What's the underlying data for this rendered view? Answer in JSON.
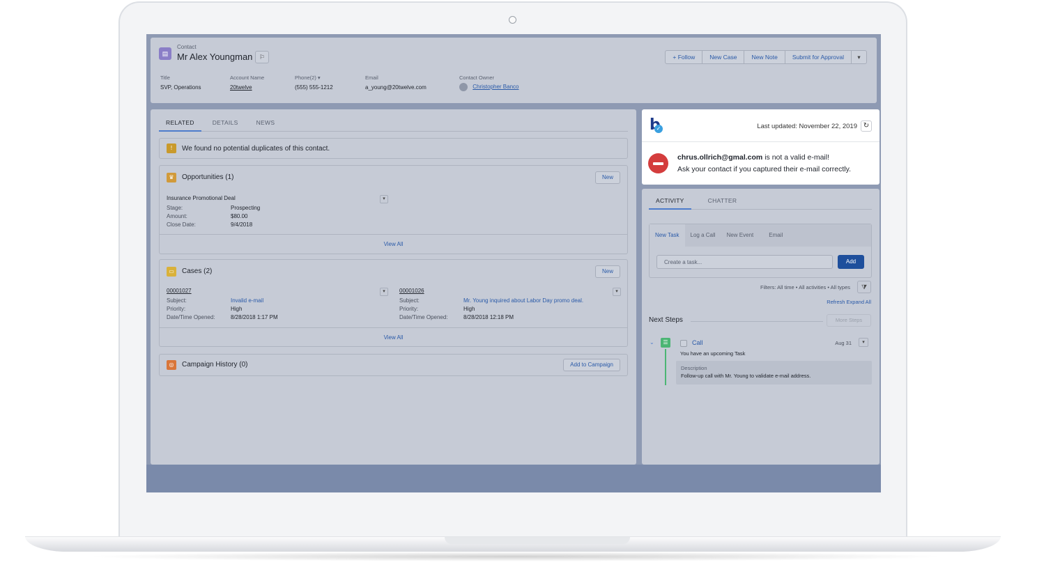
{
  "record": {
    "type_label": "Contact",
    "name": "Mr Alex Youngman",
    "follow_small": "⚐",
    "actions": [
      "+ Follow",
      "New Case",
      "New Note",
      "Submit for Approval"
    ],
    "more_action": "▾"
  },
  "fields": [
    {
      "label": "Title",
      "value": "SVP, Operations"
    },
    {
      "label": "Account Name",
      "value": "20twelve"
    },
    {
      "label": "Phone(2) ▾",
      "value": "(555) 555-1212"
    },
    {
      "label": "Email",
      "value": "a_young@20twelve.com"
    },
    {
      "label": "Contact Owner",
      "value": "Christopher Banco"
    }
  ],
  "left_tabs": [
    "RELATED",
    "DETAILS",
    "NEWS"
  ],
  "duplicates": {
    "text": "We found no potential duplicates of this contact."
  },
  "opportunities": {
    "title": "Opportunities (1)",
    "new_label": "New",
    "record_name": "Insurance Promotional Deal",
    "rows": [
      {
        "k": "Stage:",
        "v": "Prospecting"
      },
      {
        "k": "Amount:",
        "v": "$80.00"
      },
      {
        "k": "Close Date:",
        "v": "9/4/2018"
      }
    ],
    "view_all": "View All"
  },
  "cases": {
    "title": "Cases (2)",
    "new_label": "New",
    "items": [
      {
        "number": "00001027",
        "subject": "Invalid e-mail",
        "priority": "High",
        "opened": "8/28/2018 1:17 PM"
      },
      {
        "number": "00001026",
        "subject": "Mr. Young inquired about Labor Day promo deal.",
        "priority": "High",
        "opened": "8/28/2018 12:18 PM"
      }
    ],
    "labels": {
      "subject": "Subject:",
      "priority": "Priority:",
      "opened": "Date/Time Opened:"
    },
    "view_all": "View All"
  },
  "campaign": {
    "title": "Campaign History (0)",
    "button": "Add to Campaign"
  },
  "popup": {
    "last_updated": "Last updated: November 22, 2019",
    "refresh_glyph": "↻",
    "email": "chrus.ollrich@gmal.com",
    "invalid_text": " is not a valid e-mail!",
    "advice": "Ask your contact if you captured their e-mail correctly."
  },
  "right_tabs": [
    "ACTIVITY",
    "CHATTER"
  ],
  "composer": {
    "tabs": [
      "New Task",
      "Log a Call",
      "New Event",
      "Email"
    ],
    "placeholder": "Create a task...",
    "add_label": "Add"
  },
  "activity": {
    "filters": "Filters: All time • All activities • All types",
    "refresh": "Refresh",
    "expand": "Expand All",
    "next_steps": "Next Steps",
    "more_steps": "More Steps",
    "task_title": "Call",
    "task_date": "Aug 31",
    "task_sub": "You have an upcoming Task",
    "desc_label": "Description",
    "desc_value": "Follow-up call with Mr. Young to validate e-mail address."
  },
  "colors": {
    "accent": "#4d7ccc",
    "error": "#d43d3d",
    "primary_button": "#1e4f9c",
    "task_green": "#4bb574"
  }
}
